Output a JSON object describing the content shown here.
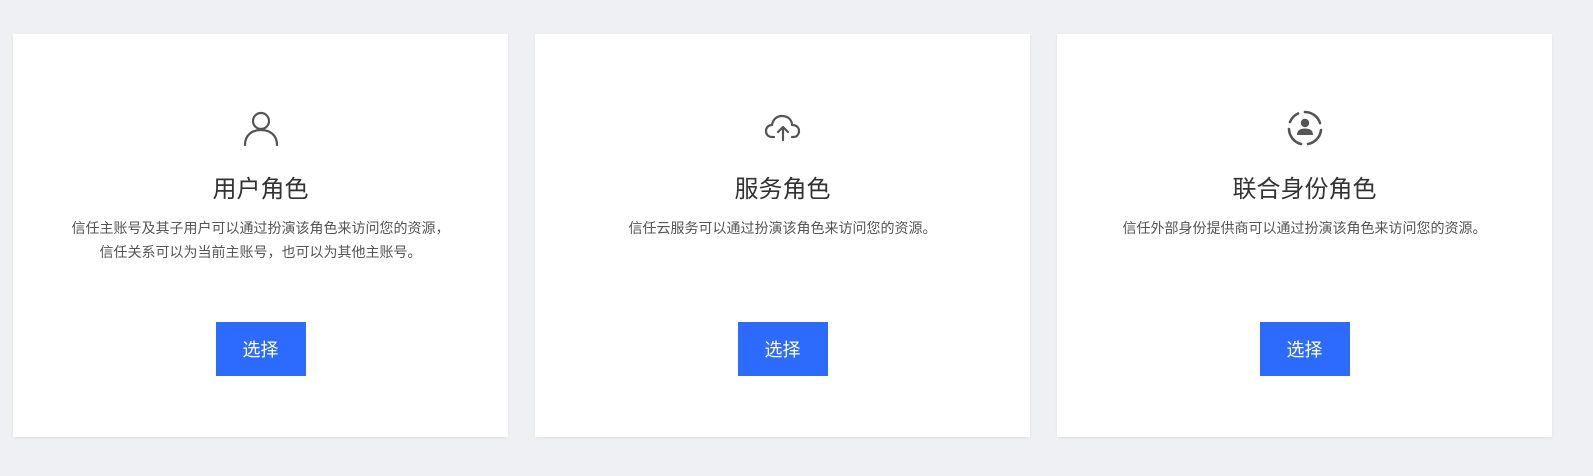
{
  "cards": [
    {
      "icon": "user-icon",
      "title": "用户角色",
      "description": "信任主账号及其子用户可以通过扮演该角色来访问您的资源，信任关系可以为当前主账号，也可以为其他主账号。",
      "button_label": "选择"
    },
    {
      "icon": "cloud-upload-icon",
      "title": "服务角色",
      "description": "信任云服务可以通过扮演该角色来访问您的资源。",
      "button_label": "选择"
    },
    {
      "icon": "federated-user-icon",
      "title": "联合身份角色",
      "description": "信任外部身份提供商可以通过扮演该角色来访问您的资源。",
      "button_label": "选择"
    }
  ],
  "colors": {
    "background": "#eff0f3",
    "card": "#ffffff",
    "primary_button": "#2d6bff",
    "icon": "#555555"
  }
}
